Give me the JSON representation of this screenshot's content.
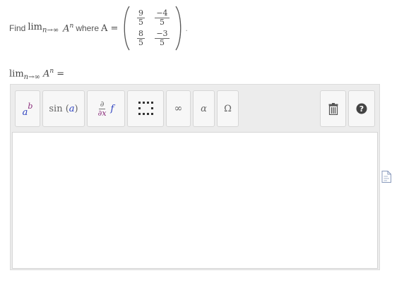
{
  "problem": {
    "find": "Find",
    "lim": "lim",
    "lim_sub": "n→∞",
    "A": "A",
    "exp": "n",
    "where": "where",
    "A_eq": "A =",
    "matrix": [
      [
        {
          "num": "9",
          "den": "5"
        },
        {
          "num": "−4",
          "den": "5"
        }
      ],
      [
        {
          "num": "8",
          "den": "5"
        },
        {
          "num": "−3",
          "den": "5"
        }
      ]
    ],
    "period": "."
  },
  "answer": {
    "lim": "lim",
    "lim_sub": "n→∞",
    "A": "A",
    "exp": "n",
    "eq": "="
  },
  "toolbar": {
    "power": {
      "base": "a",
      "exp": "b"
    },
    "sin": {
      "fn": "sin",
      "arg": "a"
    },
    "derivative": {
      "top": "∂",
      "bottom": "∂x",
      "f": "f"
    },
    "infinity": "∞",
    "alpha": "α",
    "omega": "Ω"
  },
  "answer_input": {
    "value": ""
  },
  "colors": {
    "accent_blue": "#2a3fbf",
    "accent_purple": "#8a2b7a",
    "icon_dark": "#555555"
  }
}
